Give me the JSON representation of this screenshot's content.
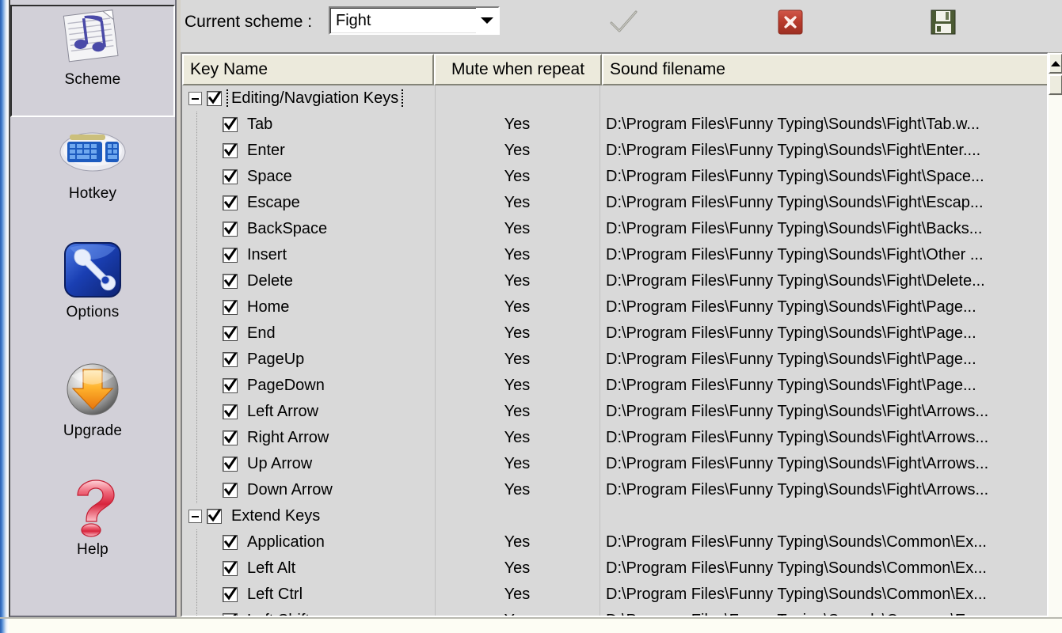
{
  "toolbar": {
    "scheme_label": "Current scheme :",
    "scheme_value": "Fight",
    "apply_title": "Apply",
    "delete_title": "Delete",
    "save_title": "Save"
  },
  "sidebar": {
    "items": [
      {
        "label": "Scheme",
        "icon": "music-sheet-icon",
        "selected": true
      },
      {
        "label": "Hotkey",
        "icon": "keyboard-icon",
        "selected": false
      },
      {
        "label": "Options",
        "icon": "wrench-icon",
        "selected": false
      },
      {
        "label": "Upgrade",
        "icon": "download-arrow-icon",
        "selected": false
      },
      {
        "label": "Help",
        "icon": "question-mark-icon",
        "selected": false
      }
    ]
  },
  "listview": {
    "columns": [
      "Key Name",
      "Mute when repeat",
      "Sound filename"
    ],
    "rows": [
      {
        "type": "group",
        "checked": true,
        "expanded": true,
        "focused": true,
        "name": "Editing/Navgiation Keys",
        "mute": "",
        "file": ""
      },
      {
        "type": "item",
        "checked": true,
        "name": "Tab",
        "mute": "Yes",
        "file": "D:\\Program Files\\Funny Typing\\Sounds\\Fight\\Tab.w..."
      },
      {
        "type": "item",
        "checked": true,
        "name": "Enter",
        "mute": "Yes",
        "file": "D:\\Program Files\\Funny Typing\\Sounds\\Fight\\Enter...."
      },
      {
        "type": "item",
        "checked": true,
        "name": "Space",
        "mute": "Yes",
        "file": "D:\\Program Files\\Funny Typing\\Sounds\\Fight\\Space..."
      },
      {
        "type": "item",
        "checked": true,
        "name": "Escape",
        "mute": "Yes",
        "file": "D:\\Program Files\\Funny Typing\\Sounds\\Fight\\Escap..."
      },
      {
        "type": "item",
        "checked": true,
        "name": "BackSpace",
        "mute": "Yes",
        "file": "D:\\Program Files\\Funny Typing\\Sounds\\Fight\\Backs..."
      },
      {
        "type": "item",
        "checked": true,
        "name": "Insert",
        "mute": "Yes",
        "file": "D:\\Program Files\\Funny Typing\\Sounds\\Fight\\Other ..."
      },
      {
        "type": "item",
        "checked": true,
        "name": "Delete",
        "mute": "Yes",
        "file": "D:\\Program Files\\Funny Typing\\Sounds\\Fight\\Delete..."
      },
      {
        "type": "item",
        "checked": true,
        "name": "Home",
        "mute": "Yes",
        "file": "D:\\Program Files\\Funny Typing\\Sounds\\Fight\\Page..."
      },
      {
        "type": "item",
        "checked": true,
        "name": "End",
        "mute": "Yes",
        "file": "D:\\Program Files\\Funny Typing\\Sounds\\Fight\\Page..."
      },
      {
        "type": "item",
        "checked": true,
        "name": "PageUp",
        "mute": "Yes",
        "file": "D:\\Program Files\\Funny Typing\\Sounds\\Fight\\Page..."
      },
      {
        "type": "item",
        "checked": true,
        "name": "PageDown",
        "mute": "Yes",
        "file": "D:\\Program Files\\Funny Typing\\Sounds\\Fight\\Page..."
      },
      {
        "type": "item",
        "checked": true,
        "name": "Left Arrow",
        "mute": "Yes",
        "file": "D:\\Program Files\\Funny Typing\\Sounds\\Fight\\Arrows..."
      },
      {
        "type": "item",
        "checked": true,
        "name": "Right Arrow",
        "mute": "Yes",
        "file": "D:\\Program Files\\Funny Typing\\Sounds\\Fight\\Arrows..."
      },
      {
        "type": "item",
        "checked": true,
        "name": "Up Arrow",
        "mute": "Yes",
        "file": "D:\\Program Files\\Funny Typing\\Sounds\\Fight\\Arrows..."
      },
      {
        "type": "item",
        "checked": true,
        "name": "Down Arrow",
        "mute": "Yes",
        "file": "D:\\Program Files\\Funny Typing\\Sounds\\Fight\\Arrows..."
      },
      {
        "type": "group",
        "checked": true,
        "expanded": true,
        "focused": false,
        "name": "Extend Keys",
        "mute": "",
        "file": ""
      },
      {
        "type": "item",
        "checked": true,
        "name": "Application",
        "mute": "Yes",
        "file": "D:\\Program Files\\Funny Typing\\Sounds\\Common\\Ex..."
      },
      {
        "type": "item",
        "checked": true,
        "name": "Left Alt",
        "mute": "Yes",
        "file": "D:\\Program Files\\Funny Typing\\Sounds\\Common\\Ex..."
      },
      {
        "type": "item",
        "checked": true,
        "name": "Left Ctrl",
        "mute": "Yes",
        "file": "D:\\Program Files\\Funny Typing\\Sounds\\Common\\Ex..."
      },
      {
        "type": "item",
        "checked": true,
        "name": "Left Shift",
        "mute": "Yes",
        "file": "D:\\Program Files\\Funny Typing\\Sounds\\Common\\Ex..."
      }
    ]
  },
  "scrollbar": {
    "up_arrow": "scroll-up-arrow"
  },
  "colors": {
    "accent_blue": "#2b5fb0",
    "header_bg": "#eceadc",
    "body_bg": "#d9d9d9",
    "sidebar_bg": "#d2d0d8",
    "delete_red": "#c0392b"
  }
}
